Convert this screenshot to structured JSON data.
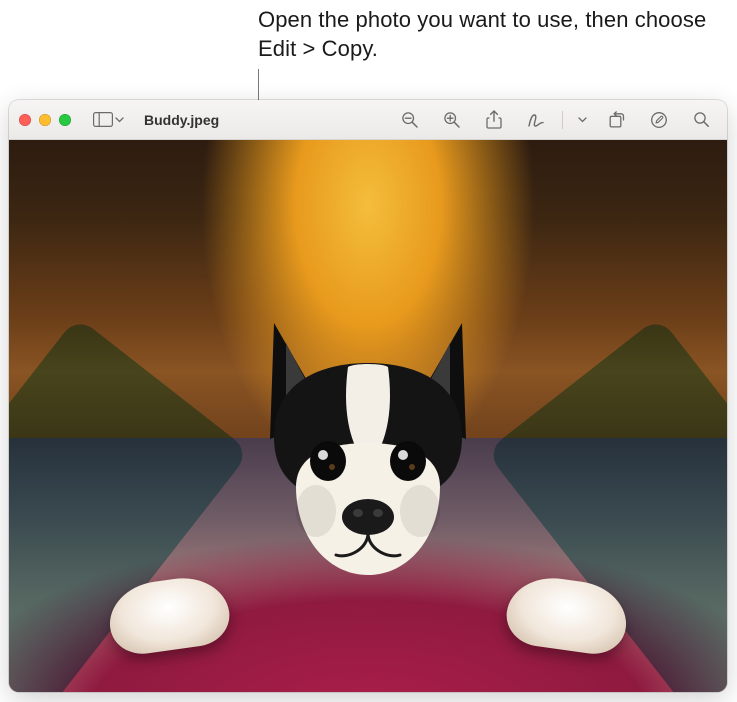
{
  "callout": {
    "text": "Open the photo you want to use, then choose Edit > Copy."
  },
  "window": {
    "document_title": "Buddy.jpeg"
  },
  "toolbar": {
    "sidebar_icon": "sidebar-icon",
    "zoom_out": "zoom-out-icon",
    "zoom_in": "zoom-in-icon",
    "share": "share-icon",
    "markup": "markup-icon",
    "markup_menu": "chevron-down-icon",
    "rotate": "rotate-left-icon",
    "edit": "edit-circle-icon",
    "search": "search-icon"
  }
}
